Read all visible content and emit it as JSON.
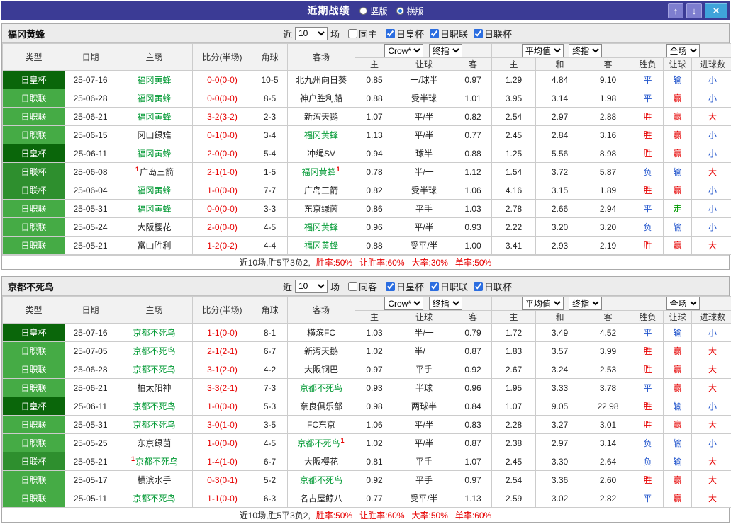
{
  "titlebar": {
    "title": "近期战绩",
    "layout_options": [
      {
        "label": "竖版",
        "selected": false
      },
      {
        "label": "横版",
        "selected": true
      }
    ],
    "buttons": {
      "up": "↑",
      "down": "↓",
      "close": "×"
    }
  },
  "labels": {
    "near": "近",
    "games": "场"
  },
  "columns": {
    "type": "类型",
    "date": "日期",
    "home": "主场",
    "score": "比分(半场)",
    "corners": "角球",
    "away": "客场",
    "odds_home": "主",
    "odds_handicap": "让球",
    "odds_away": "客",
    "avg_home": "主",
    "avg_draw": "和",
    "avg_away": "客",
    "result": "胜负",
    "handicap": "让球",
    "goals": "进球数"
  },
  "selects": {
    "odds_source": "Crow*",
    "odds_time": "终指",
    "avg_source": "平均值",
    "avg_time": "终指",
    "scope": "全场"
  },
  "colors": {
    "focus_team": "#009933",
    "score": "#e60000",
    "badge": "#e60000",
    "type_bg": {
      "日皇杯": "#0a660a",
      "日职联": "#45ab45",
      "日联杯": "#2e8f2e"
    },
    "values": {
      "胜": "#e60000",
      "平": "#2255cc",
      "负": "#2255cc",
      "赢": "#e60000",
      "输": "#2255cc",
      "走": "#009900",
      "大": "#e60000",
      "小": "#2255cc"
    }
  },
  "sections": [
    {
      "team": "福冈黄蜂",
      "filter": {
        "count": "10",
        "same_label": "同主",
        "same_checked": false,
        "competitions": [
          {
            "label": "日皇杯",
            "checked": true
          },
          {
            "label": "日职联",
            "checked": true
          },
          {
            "label": "日联杯",
            "checked": true
          }
        ]
      },
      "rows": [
        {
          "type": "日皇杯",
          "date": "25-07-16",
          "home": {
            "name": "福冈黄蜂",
            "focus": true
          },
          "score": "0-0(0-0)",
          "corners": "10-5",
          "away": {
            "name": "北九州向日葵",
            "focus": false
          },
          "odds": [
            "0.85",
            "一/球半",
            "0.97"
          ],
          "avg": [
            "1.29",
            "4.84",
            "9.10"
          ],
          "result": "平",
          "handicap": "输",
          "goals": "小"
        },
        {
          "type": "日职联",
          "date": "25-06-28",
          "home": {
            "name": "福冈黄蜂",
            "focus": true
          },
          "score": "0-0(0-0)",
          "corners": "8-5",
          "away": {
            "name": "神户胜利船",
            "focus": false
          },
          "odds": [
            "0.88",
            "受半球",
            "1.01"
          ],
          "avg": [
            "3.95",
            "3.14",
            "1.98"
          ],
          "result": "平",
          "handicap": "赢",
          "goals": "小"
        },
        {
          "type": "日职联",
          "date": "25-06-21",
          "home": {
            "name": "福冈黄蜂",
            "focus": true
          },
          "score": "3-2(3-2)",
          "corners": "2-3",
          "away": {
            "name": "新泻天鹅",
            "focus": false
          },
          "odds": [
            "1.07",
            "平/半",
            "0.82"
          ],
          "avg": [
            "2.54",
            "2.97",
            "2.88"
          ],
          "result": "胜",
          "handicap": "赢",
          "goals": "大"
        },
        {
          "type": "日职联",
          "date": "25-06-15",
          "home": {
            "name": "冈山绿雉",
            "focus": false
          },
          "score": "0-1(0-0)",
          "corners": "3-4",
          "away": {
            "name": "福冈黄蜂",
            "focus": true
          },
          "odds": [
            "1.13",
            "平/半",
            "0.77"
          ],
          "avg": [
            "2.45",
            "2.84",
            "3.16"
          ],
          "result": "胜",
          "handicap": "赢",
          "goals": "小"
        },
        {
          "type": "日皇杯",
          "date": "25-06-11",
          "home": {
            "name": "福冈黄蜂",
            "focus": true
          },
          "score": "2-0(0-0)",
          "corners": "5-4",
          "away": {
            "name": "冲绳SV",
            "focus": false
          },
          "odds": [
            "0.94",
            "球半",
            "0.88"
          ],
          "avg": [
            "1.25",
            "5.56",
            "8.98"
          ],
          "result": "胜",
          "handicap": "赢",
          "goals": "小"
        },
        {
          "type": "日联杯",
          "date": "25-06-08",
          "home": {
            "name": "广岛三箭",
            "focus": false,
            "pre": "1"
          },
          "score": "2-1(1-0)",
          "corners": "1-5",
          "away": {
            "name": "福冈黄蜂",
            "focus": true,
            "suf": "1"
          },
          "odds": [
            "0.78",
            "半/一",
            "1.12"
          ],
          "avg": [
            "1.54",
            "3.72",
            "5.87"
          ],
          "result": "负",
          "handicap": "输",
          "goals": "大"
        },
        {
          "type": "日联杯",
          "date": "25-06-04",
          "home": {
            "name": "福冈黄蜂",
            "focus": true
          },
          "score": "1-0(0-0)",
          "corners": "7-7",
          "away": {
            "name": "广岛三箭",
            "focus": false
          },
          "odds": [
            "0.82",
            "受半球",
            "1.06"
          ],
          "avg": [
            "4.16",
            "3.15",
            "1.89"
          ],
          "result": "胜",
          "handicap": "赢",
          "goals": "小"
        },
        {
          "type": "日职联",
          "date": "25-05-31",
          "home": {
            "name": "福冈黄蜂",
            "focus": true
          },
          "score": "0-0(0-0)",
          "corners": "3-3",
          "away": {
            "name": "东京绿茵",
            "focus": false
          },
          "odds": [
            "0.86",
            "平手",
            "1.03"
          ],
          "avg": [
            "2.78",
            "2.66",
            "2.94"
          ],
          "result": "平",
          "handicap": "走",
          "goals": "小"
        },
        {
          "type": "日职联",
          "date": "25-05-24",
          "home": {
            "name": "大阪樱花",
            "focus": false
          },
          "score": "2-0(0-0)",
          "corners": "4-5",
          "away": {
            "name": "福冈黄蜂",
            "focus": true
          },
          "odds": [
            "0.96",
            "平/半",
            "0.93"
          ],
          "avg": [
            "2.22",
            "3.20",
            "3.20"
          ],
          "result": "负",
          "handicap": "输",
          "goals": "小"
        },
        {
          "type": "日职联",
          "date": "25-05-21",
          "home": {
            "name": "富山胜利",
            "focus": false
          },
          "score": "1-2(0-2)",
          "corners": "4-4",
          "away": {
            "name": "福冈黄蜂",
            "focus": true
          },
          "odds": [
            "0.88",
            "受平/半",
            "1.00"
          ],
          "avg": [
            "3.41",
            "2.93",
            "2.19"
          ],
          "result": "胜",
          "handicap": "赢",
          "goals": "大"
        }
      ],
      "summary": {
        "prefix": "近10场,胜5平3负2,",
        "stats": [
          "胜率:50%",
          "让胜率:60%",
          "大率:30%",
          "单率:50%"
        ]
      }
    },
    {
      "team": "京都不死鸟",
      "filter": {
        "count": "10",
        "same_label": "同客",
        "same_checked": false,
        "competitions": [
          {
            "label": "日皇杯",
            "checked": true
          },
          {
            "label": "日职联",
            "checked": true
          },
          {
            "label": "日联杯",
            "checked": true
          }
        ]
      },
      "rows": [
        {
          "type": "日皇杯",
          "date": "25-07-16",
          "home": {
            "name": "京都不死鸟",
            "focus": true
          },
          "score": "1-1(0-0)",
          "corners": "8-1",
          "away": {
            "name": "横滨FC",
            "focus": false
          },
          "odds": [
            "1.03",
            "半/一",
            "0.79"
          ],
          "avg": [
            "1.72",
            "3.49",
            "4.52"
          ],
          "result": "平",
          "handicap": "输",
          "goals": "小"
        },
        {
          "type": "日职联",
          "date": "25-07-05",
          "home": {
            "name": "京都不死鸟",
            "focus": true
          },
          "score": "2-1(2-1)",
          "corners": "6-7",
          "away": {
            "name": "新泻天鹅",
            "focus": false
          },
          "odds": [
            "1.02",
            "半/一",
            "0.87"
          ],
          "avg": [
            "1.83",
            "3.57",
            "3.99"
          ],
          "result": "胜",
          "handicap": "赢",
          "goals": "大"
        },
        {
          "type": "日职联",
          "date": "25-06-28",
          "home": {
            "name": "京都不死鸟",
            "focus": true
          },
          "score": "3-1(2-0)",
          "corners": "4-2",
          "away": {
            "name": "大阪钢巴",
            "focus": false
          },
          "odds": [
            "0.97",
            "平手",
            "0.92"
          ],
          "avg": [
            "2.67",
            "3.24",
            "2.53"
          ],
          "result": "胜",
          "handicap": "赢",
          "goals": "大"
        },
        {
          "type": "日职联",
          "date": "25-06-21",
          "home": {
            "name": "柏太阳神",
            "focus": false
          },
          "score": "3-3(2-1)",
          "corners": "7-3",
          "away": {
            "name": "京都不死鸟",
            "focus": true
          },
          "odds": [
            "0.93",
            "半球",
            "0.96"
          ],
          "avg": [
            "1.95",
            "3.33",
            "3.78"
          ],
          "result": "平",
          "handicap": "赢",
          "goals": "大"
        },
        {
          "type": "日皇杯",
          "date": "25-06-11",
          "home": {
            "name": "京都不死鸟",
            "focus": true
          },
          "score": "1-0(0-0)",
          "corners": "5-3",
          "away": {
            "name": "奈良俱乐部",
            "focus": false
          },
          "odds": [
            "0.98",
            "两球半",
            "0.84"
          ],
          "avg": [
            "1.07",
            "9.05",
            "22.98"
          ],
          "result": "胜",
          "handicap": "输",
          "goals": "小"
        },
        {
          "type": "日职联",
          "date": "25-05-31",
          "home": {
            "name": "京都不死鸟",
            "focus": true
          },
          "score": "3-0(1-0)",
          "corners": "3-5",
          "away": {
            "name": "FC东京",
            "focus": false
          },
          "odds": [
            "1.06",
            "平/半",
            "0.83"
          ],
          "avg": [
            "2.28",
            "3.27",
            "3.01"
          ],
          "result": "胜",
          "handicap": "赢",
          "goals": "大"
        },
        {
          "type": "日职联",
          "date": "25-05-25",
          "home": {
            "name": "东京绿茵",
            "focus": false
          },
          "score": "1-0(0-0)",
          "corners": "4-5",
          "away": {
            "name": "京都不死鸟",
            "focus": true,
            "suf": "1"
          },
          "odds": [
            "1.02",
            "平/半",
            "0.87"
          ],
          "avg": [
            "2.38",
            "2.97",
            "3.14"
          ],
          "result": "负",
          "handicap": "输",
          "goals": "小"
        },
        {
          "type": "日联杯",
          "date": "25-05-21",
          "home": {
            "name": "京都不死鸟",
            "focus": true,
            "pre": "1"
          },
          "score": "1-4(1-0)",
          "corners": "6-7",
          "away": {
            "name": "大阪樱花",
            "focus": false
          },
          "odds": [
            "0.81",
            "平手",
            "1.07"
          ],
          "avg": [
            "2.45",
            "3.30",
            "2.64"
          ],
          "result": "负",
          "handicap": "输",
          "goals": "大"
        },
        {
          "type": "日职联",
          "date": "25-05-17",
          "home": {
            "name": "横滨水手",
            "focus": false
          },
          "score": "0-3(0-1)",
          "corners": "5-2",
          "away": {
            "name": "京都不死鸟",
            "focus": true
          },
          "odds": [
            "0.92",
            "平手",
            "0.97"
          ],
          "avg": [
            "2.54",
            "3.36",
            "2.60"
          ],
          "result": "胜",
          "handicap": "赢",
          "goals": "大"
        },
        {
          "type": "日职联",
          "date": "25-05-11",
          "home": {
            "name": "京都不死鸟",
            "focus": true
          },
          "score": "1-1(0-0)",
          "corners": "6-3",
          "away": {
            "name": "名古屋鲸八",
            "focus": false
          },
          "odds": [
            "0.77",
            "受平/半",
            "1.13"
          ],
          "avg": [
            "2.59",
            "3.02",
            "2.82"
          ],
          "result": "平",
          "handicap": "赢",
          "goals": "大"
        }
      ],
      "summary": {
        "prefix": "近10场,胜5平3负2,",
        "stats": [
          "胜率:50%",
          "让胜率:60%",
          "大率:50%",
          "单率:60%"
        ]
      }
    }
  ]
}
